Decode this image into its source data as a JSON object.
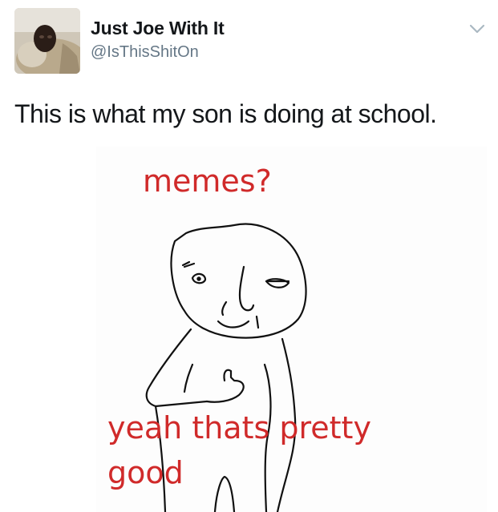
{
  "tweet": {
    "display_name": "Just Joe With It",
    "handle": "@IsThisShitOn",
    "text": "This is what my son is doing at school.",
    "menu_icon": "chevron-down-icon"
  },
  "media": {
    "caption_top": "memes?",
    "caption_bottom_line1": "yeah thats pretty",
    "caption_bottom_line2": "good",
    "caption_color": "#d02a2a"
  },
  "colors": {
    "name": "#14171a",
    "handle": "#657786",
    "chevron": "#aab8c2"
  }
}
